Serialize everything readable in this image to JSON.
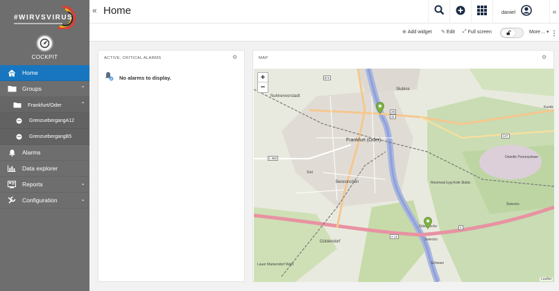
{
  "brand": {
    "logo_text": "#WIRVSVIRUS",
    "app_label": "COCKPIT"
  },
  "sidebar": {
    "items": [
      {
        "label": "Home",
        "icon": "home-icon",
        "active": true
      },
      {
        "label": "Groups",
        "icon": "folder-icon",
        "expanded": true
      },
      {
        "label": "Frankfurt/Oder",
        "icon": "folder-icon",
        "expanded": true
      },
      {
        "label": "GrenzuebergangA12",
        "icon": "device-icon"
      },
      {
        "label": "GrenzuebergangB5",
        "icon": "device-icon"
      },
      {
        "label": "Alarms",
        "icon": "bell-icon"
      },
      {
        "label": "Data explorer",
        "icon": "bar-chart-icon"
      },
      {
        "label": "Reports",
        "icon": "reports-icon",
        "expandable": true
      },
      {
        "label": "Configuration",
        "icon": "wrench-icon",
        "expandable": true
      }
    ]
  },
  "header": {
    "title": "Home",
    "user": "daniel",
    "icons": [
      "search-icon",
      "plus-circle-icon",
      "apps-grid-icon",
      "user-circle-icon"
    ]
  },
  "actions": {
    "add_widget": "Add widget",
    "edit": "Edit",
    "full_screen": "Full screen",
    "more": "More…"
  },
  "alarms_widget": {
    "title": "ACTIVE, CRITICAL ALARMS",
    "empty_message": "No alarms to display."
  },
  "map_widget": {
    "title": "MAP",
    "zoom_in": "+",
    "zoom_out": "−",
    "attribution": "Leaflet",
    "labels": {
      "city": "Frankfurt (Oder)",
      "slubice": "Słubice",
      "nuhnen": "Nuhnenvorstadt",
      "beresinchen": "Beresinchen",
      "guldendorf": "Güldendorf",
      "swiecko": "Świecko",
      "osiedle": "Osiedle Przemysłowe",
      "sud": "Süd",
      "rezerwat": "Rezerwat Łęg-Kołe Słubic",
      "swiecko2": "Świecko",
      "schwarz": "Schwarz",
      "odd": "Oderbrücke",
      "lauer": "Lauer Markendorf Wald",
      "kunitz": "Kunitz"
    },
    "road_shields": [
      "B 5",
      "L 382",
      "A 12",
      "29",
      "31",
      "137",
      "2"
    ]
  },
  "colors": {
    "sidebar": "#6e6e6e",
    "active": "#1776bf",
    "pin": "#7cb342"
  }
}
